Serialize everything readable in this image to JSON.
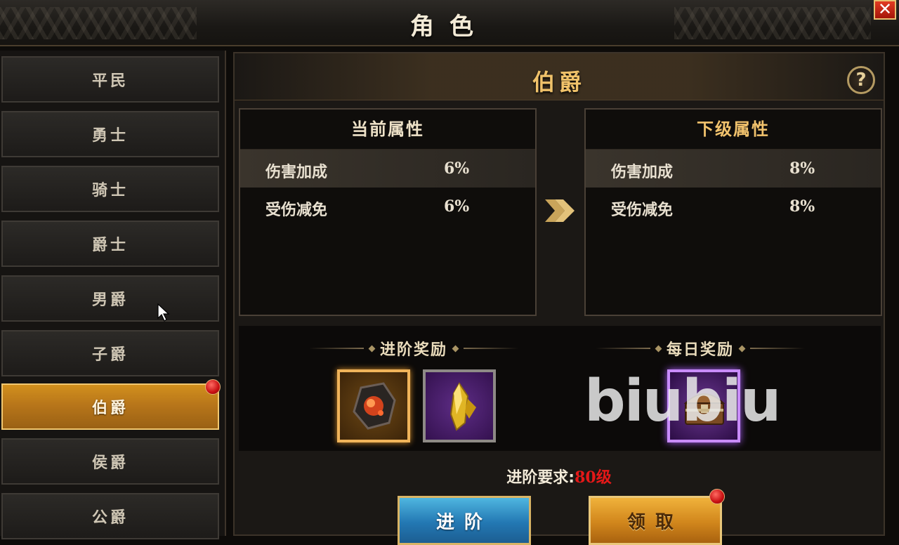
{
  "window": {
    "title": "角色",
    "close_label": "✕"
  },
  "sidebar": {
    "items": [
      {
        "label": "平民"
      },
      {
        "label": "勇士"
      },
      {
        "label": "骑士"
      },
      {
        "label": "爵士"
      },
      {
        "label": "男爵"
      },
      {
        "label": "子爵"
      },
      {
        "label": "伯爵",
        "selected": true,
        "has_red_dot": true
      },
      {
        "label": "侯爵"
      },
      {
        "label": "公爵"
      }
    ]
  },
  "main": {
    "rank_title": "伯爵",
    "help_label": "?",
    "current": {
      "heading": "当前属性",
      "rows": [
        {
          "name": "伤害加成",
          "value": "6%"
        },
        {
          "name": "受伤减免",
          "value": "6%"
        }
      ]
    },
    "next": {
      "heading": "下级属性",
      "rows": [
        {
          "name": "伤害加成",
          "value": "8%"
        },
        {
          "name": "受伤减免",
          "value": "8%"
        }
      ]
    },
    "advance_reward": {
      "heading": "进阶奖励",
      "items": [
        {
          "icon": "ore-chunk-icon",
          "rarity": "gold"
        },
        {
          "icon": "gold-crystal-icon",
          "rarity": "purple"
        }
      ]
    },
    "daily_reward": {
      "heading": "每日奖励",
      "items": [
        {
          "icon": "treasure-chest-icon",
          "rarity": "purple"
        }
      ]
    },
    "requirement": {
      "label": "进阶要求:",
      "level": "80级"
    },
    "buttons": {
      "advance": "进阶",
      "claim": "领取"
    }
  },
  "watermark": "biubiu",
  "colors": {
    "accent_gold": "#f0c26a",
    "selected_bg": "#b8761a",
    "requirement_red": "#e51818"
  }
}
